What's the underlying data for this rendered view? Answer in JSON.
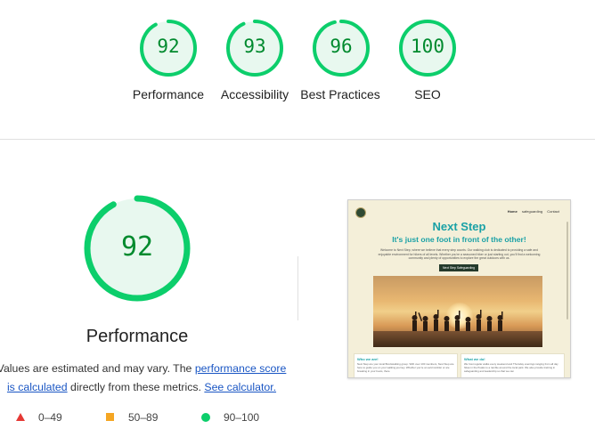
{
  "categories": [
    {
      "score": "92",
      "label": "Performance",
      "fraction": 0.92
    },
    {
      "score": "93",
      "label": "Accessibility",
      "fraction": 0.93
    },
    {
      "score": "96",
      "label": "Best Practices",
      "fraction": 0.96
    },
    {
      "score": "100",
      "label": "SEO",
      "fraction": 1.0
    }
  ],
  "main": {
    "score": "92",
    "fraction": 0.92,
    "title": "Performance",
    "desc_prefix": "Values are estimated and may vary. The",
    "desc_link1": "performance score is calculated",
    "desc_middle": "directly from these metrics.",
    "desc_link2": "See calculator."
  },
  "legend": [
    {
      "symbol": "triangle",
      "range": "0–49",
      "color": "#e53935"
    },
    {
      "symbol": "square",
      "range": "50–89",
      "color": "#f5a623"
    },
    {
      "symbol": "circle",
      "range": "90–100",
      "color": "#0cce6b"
    }
  ],
  "colors": {
    "pass": "#0cce6b",
    "pass_bg": "#e8f8ef",
    "pass_text": "#008a2e"
  },
  "screenshot": {
    "nav": [
      "Home",
      "safeguarding",
      "Contact"
    ],
    "title": "Next Step",
    "subtitle": "It's just one foot in front of the other!",
    "intro": "Welcome to Next Step, where we believe that every step counts. Our walking club is dedicated to providing a safe and enjoyable environment for hikers of all levels. Whether you're a seasoned hiker or just starting out, you'll find a welcoming community and plenty of opportunities to explore the great outdoors with us.",
    "button": "Next Step Safeguarding",
    "card1_title": "Who we are!",
    "card1_text": "Next Step are your local Brockwalking group. With over 100 members, Next Step are here to guide you on your walking journey. Whether you're an avid rambler or are breaking in your boots, there",
    "card2_title": "What we do!",
    "card2_text": "We host regular walks every weekend and Thursday evenings ranging from all day hikes in the Peaks to a ramble around the local park. We also provide training in safeguarding and leadership so that we can"
  }
}
